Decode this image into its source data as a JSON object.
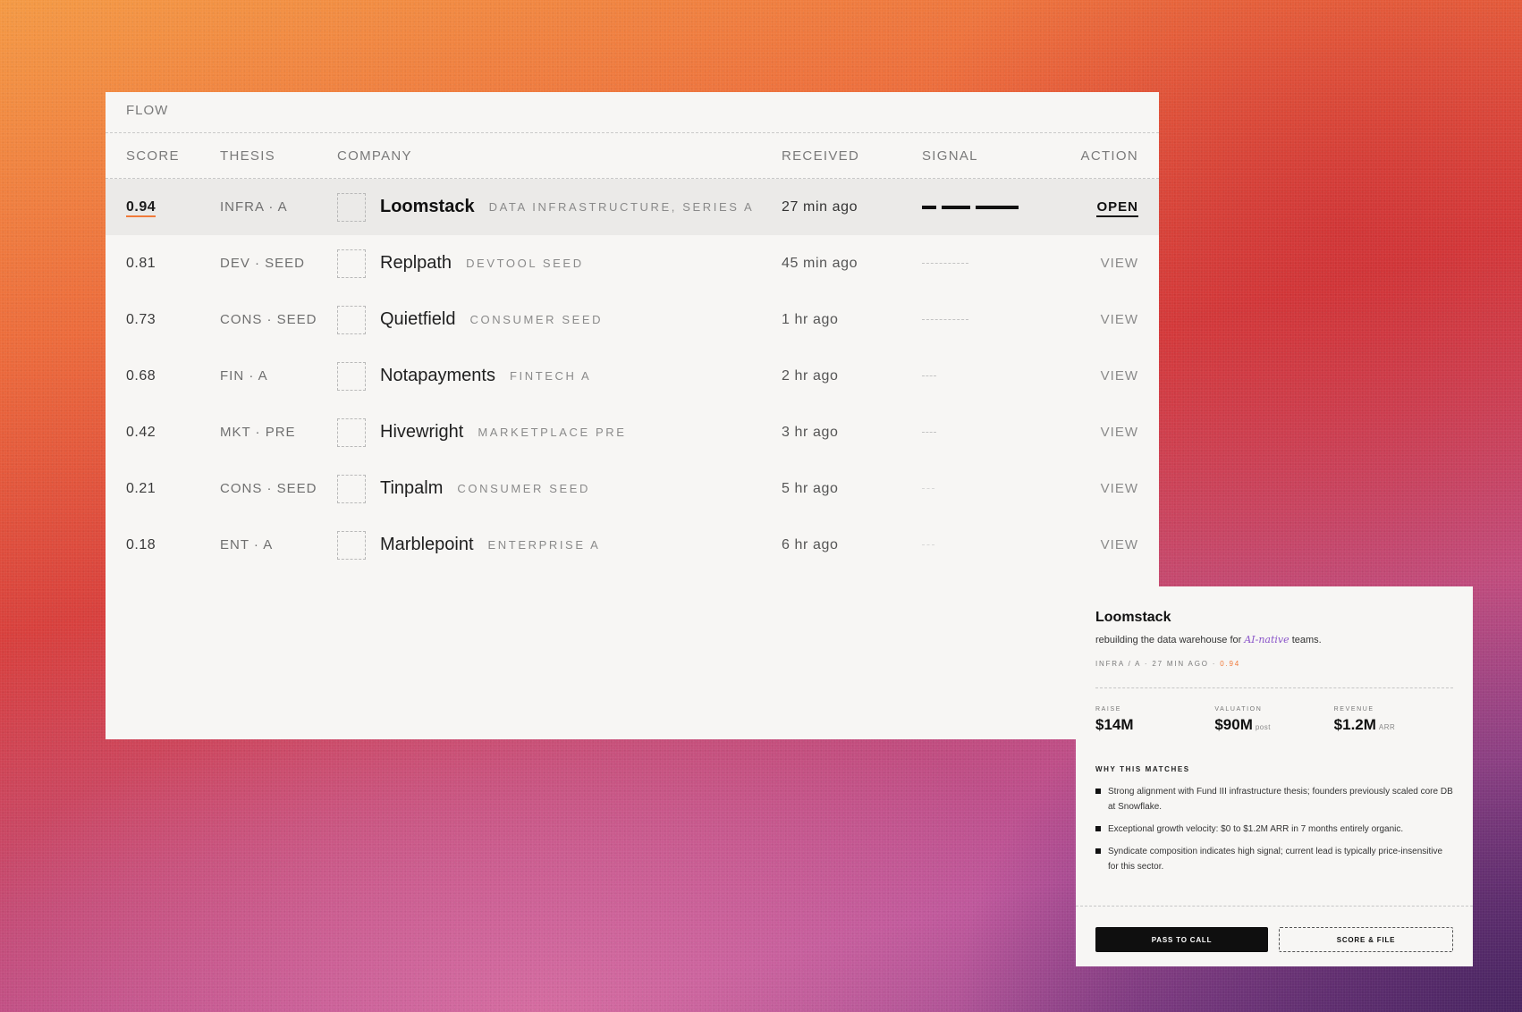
{
  "panel": {
    "title": "FLOW"
  },
  "columns": {
    "score": "SCORE",
    "thesis": "THESIS",
    "company": "COMPANY",
    "received": "RECEIVED",
    "signal": "SIGNAL",
    "action": "ACTION"
  },
  "rows": [
    {
      "score": "0.94",
      "thesis": "INFRA · A",
      "name": "Loomstack",
      "tag": "DATA INFRASTRUCTURE, SERIES A",
      "received": "27 min ago",
      "signal": "strong",
      "action": "OPEN"
    },
    {
      "score": "0.81",
      "thesis": "DEV · SEED",
      "name": "Replpath",
      "tag": "DEVTOOL SEED",
      "received": "45 min ago",
      "signal": "weak",
      "action": "VIEW"
    },
    {
      "score": "0.73",
      "thesis": "CONS · SEED",
      "name": "Quietfield",
      "tag": "CONSUMER SEED",
      "received": "1 hr ago",
      "signal": "weak",
      "action": "VIEW"
    },
    {
      "score": "0.68",
      "thesis": "FIN · A",
      "name": "Notapayments",
      "tag": "FINTECH A",
      "received": "2 hr ago",
      "signal": "minimal",
      "action": "VIEW"
    },
    {
      "score": "0.42",
      "thesis": "MKT · PRE",
      "name": "Hivewright",
      "tag": "MARKETPLACE PRE",
      "received": "3 hr ago",
      "signal": "minimal",
      "action": "VIEW"
    },
    {
      "score": "0.21",
      "thesis": "CONS · SEED",
      "name": "Tinpalm",
      "tag": "CONSUMER SEED",
      "received": "5 hr ago",
      "signal": "none",
      "action": "VIEW"
    },
    {
      "score": "0.18",
      "thesis": "ENT · A",
      "name": "Marblepoint",
      "tag": "ENTERPRISE A",
      "received": "6 hr ago",
      "signal": "none",
      "action": "VIEW"
    }
  ],
  "detail": {
    "name": "Loomstack",
    "desc_pre": "rebuilding the data warehouse for ",
    "desc_em": "AI-native",
    "desc_post": " teams.",
    "meta": "INFRA / A · 27 MIN AGO · ",
    "meta_score": "0.94",
    "stats": [
      {
        "label": "RAISE",
        "value": "$14M",
        "suffix": ""
      },
      {
        "label": "VALUATION",
        "value": "$90M",
        "suffix": "post"
      },
      {
        "label": "REVENUE",
        "value": "$1.2M",
        "suffix": "ARR"
      }
    ],
    "why_label": "WHY THIS MATCHES",
    "reasons": [
      "Strong alignment with Fund III infrastructure thesis; founders previously scaled core DB at Snowflake.",
      "Exceptional growth velocity: $0 to $1.2M ARR in 7 months entirely organic.",
      "Syndicate composition indicates high signal; current lead is typically price-insensitive for this sector."
    ],
    "buttons": {
      "primary": "PASS TO CALL",
      "secondary": "SCORE & FILE"
    }
  },
  "colors": {
    "accent": "#f07a3a",
    "highlight": "#8a55c9",
    "ink": "#111111",
    "panel": "#f7f6f4"
  }
}
